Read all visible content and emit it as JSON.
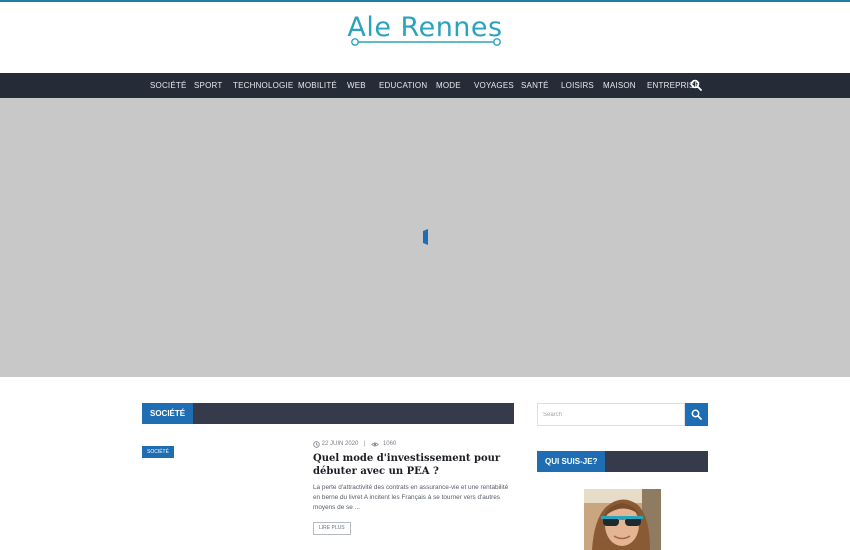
{
  "site": {
    "title": "Ale Rennes"
  },
  "nav": {
    "items": [
      {
        "label": "SOCIÉTÉ"
      },
      {
        "label": "SPORT"
      },
      {
        "label": "TECHNOLOGIE"
      },
      {
        "label": "MOBILITÉ"
      },
      {
        "label": "WEB"
      },
      {
        "label": "EDUCATION"
      },
      {
        "label": "MODE"
      },
      {
        "label": "VOYAGES"
      },
      {
        "label": "SANTÉ"
      },
      {
        "label": "LOISIRS"
      },
      {
        "label": "MAISON"
      },
      {
        "label": "ENTREPRISE"
      }
    ],
    "search_icon": "search-icon"
  },
  "section": {
    "label": "SOCIÉTÉ"
  },
  "post": {
    "category": "SOCIÉTÉ",
    "date": "22 JUIN 2020",
    "views": "1060",
    "title": "Quel mode d'investissement pour débuter avec un PEA ?",
    "excerpt": "La perte d'attractivité des contrats en assurance-vie et une rentabilité en berne du livret A incitent les Français à se tourner vers d'autres moyens de se ...",
    "read_more": "LIRE PLUS"
  },
  "sidebar": {
    "search_placeholder": "Search",
    "about_title": "QUI SUIS-JE?"
  },
  "colors": {
    "accent": "#1f6db3",
    "navbar": "#252b37",
    "logo": "#2aa3be",
    "hero": "#c8c8c8"
  }
}
